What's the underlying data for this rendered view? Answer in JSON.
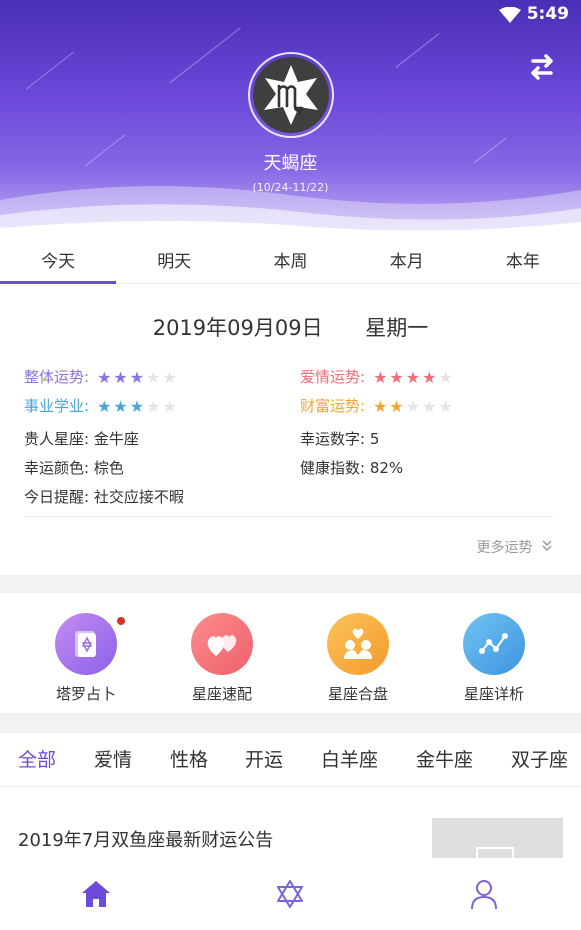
{
  "status_bar": {
    "time": "5:49"
  },
  "header": {
    "sign_name": "天蝎座",
    "sign_dates": "(10/24-11/22)",
    "sign_icon": "scorpio-icon",
    "switch_icon": "swap-arrows-icon"
  },
  "period_tabs": [
    {
      "label": "今天",
      "active": true
    },
    {
      "label": "明天",
      "active": false
    },
    {
      "label": "本周",
      "active": false
    },
    {
      "label": "本月",
      "active": false
    },
    {
      "label": "本年",
      "active": false
    }
  ],
  "fortune": {
    "date": "2019年09月09日",
    "weekday": "星期一",
    "ratings": [
      {
        "label": "整体运势:",
        "stars": 3,
        "max": 5,
        "color": "#8b73e0"
      },
      {
        "label": "爱情运势:",
        "stars": 4,
        "max": 5,
        "color": "#ee6f7a"
      },
      {
        "label": "事业学业:",
        "stars": 3,
        "max": 5,
        "color": "#4aa4d8"
      },
      {
        "label": "财富运势:",
        "stars": 2,
        "max": 5,
        "color": "#f2a534"
      }
    ],
    "info": [
      {
        "label": "贵人星座:",
        "value": "金牛座"
      },
      {
        "label": "幸运数字:",
        "value": "5"
      },
      {
        "label": "幸运颜色:",
        "value": "棕色"
      },
      {
        "label": "健康指数:",
        "value": "82%"
      },
      {
        "label": "今日提醒:",
        "value": "社交应接不暇"
      }
    ],
    "more_label": "更多运势"
  },
  "tools": [
    {
      "label": "塔罗占卜",
      "icon": "tarot-card-icon",
      "color_from": "#c48df2",
      "color_to": "#8b5fe8",
      "has_badge": true
    },
    {
      "label": "星座速配",
      "icon": "hearts-icon",
      "color_from": "#fb8c8c",
      "color_to": "#f0606c",
      "has_badge": false
    },
    {
      "label": "星座合盘",
      "icon": "couple-hearts-icon",
      "color_from": "#fbc35a",
      "color_to": "#f59a2b",
      "has_badge": false
    },
    {
      "label": "星座详析",
      "icon": "constellation-icon",
      "color_from": "#6fc5f1",
      "color_to": "#3d93e0",
      "has_badge": false
    }
  ],
  "categories": [
    {
      "label": "全部",
      "active": true
    },
    {
      "label": "爱情",
      "active": false
    },
    {
      "label": "性格",
      "active": false
    },
    {
      "label": "开运",
      "active": false
    },
    {
      "label": "白羊座",
      "active": false
    },
    {
      "label": "金牛座",
      "active": false
    },
    {
      "label": "双子座",
      "active": false
    }
  ],
  "article": {
    "title": "2019年7月双鱼座最新财运公告"
  },
  "bottom_nav": [
    {
      "icon": "home-icon",
      "active": true
    },
    {
      "icon": "star-of-david-icon",
      "active": false
    },
    {
      "icon": "user-profile-icon",
      "active": false
    }
  ],
  "colors": {
    "accent": "#6d4ad8"
  }
}
